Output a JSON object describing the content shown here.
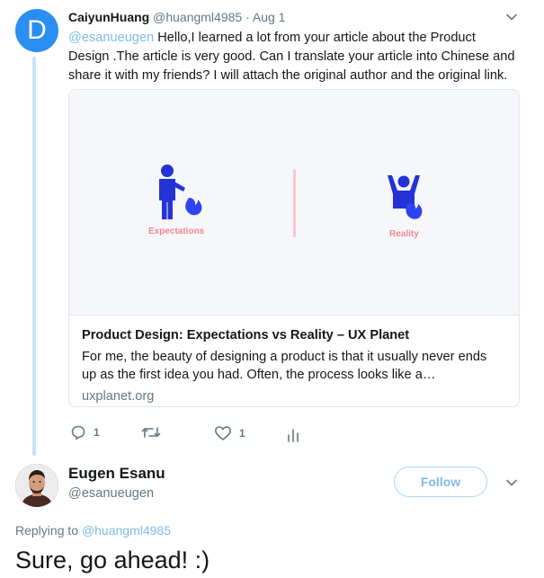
{
  "colors": {
    "accent": "#1da1f2",
    "accent_light": "#7fbbe8",
    "thread_line": "#c4e3f7",
    "muted_text": "#657786",
    "avatar_blue": "#2a8ef3",
    "illustration_blue": "#2433d6",
    "illustration_flame": "#2e44f2",
    "illustration_label": "#f2878f"
  },
  "reply_tweet": {
    "avatar_letter": "D",
    "author_name": "CaiyunHuang",
    "author_handle": "@huangml4985",
    "separator": "·",
    "date": "Aug 1",
    "mention": "@esanueugen",
    "text": " Hello,I learned a lot from your article about the Product Design .The article is very good. Can I translate your article into Chinese and share it with my friends? I will attach the original author and the original link.",
    "card": {
      "image_label_left": "Expectations",
      "image_label_right": "Reality",
      "title": "Product Design: Expectations vs Reality – UX Planet",
      "description": "For me, the beauty of designing a product is that it usually never ends up as the first idea you had. Often, the process looks like a…",
      "domain": "uxplanet.org"
    },
    "actions": {
      "reply_icon": "reply-icon",
      "reply_count": "1",
      "retweet_icon": "retweet-icon",
      "like_icon": "heart-icon",
      "like_count": "1",
      "stats_icon": "analytics-icon"
    }
  },
  "main_tweet": {
    "author_name": "Eugen Esanu",
    "author_handle": "@esanueugen",
    "follow_label": "Follow",
    "replying_prefix": "Replying to ",
    "replying_handle": "@huangml4985",
    "text": "Sure, go ahead! :)"
  }
}
